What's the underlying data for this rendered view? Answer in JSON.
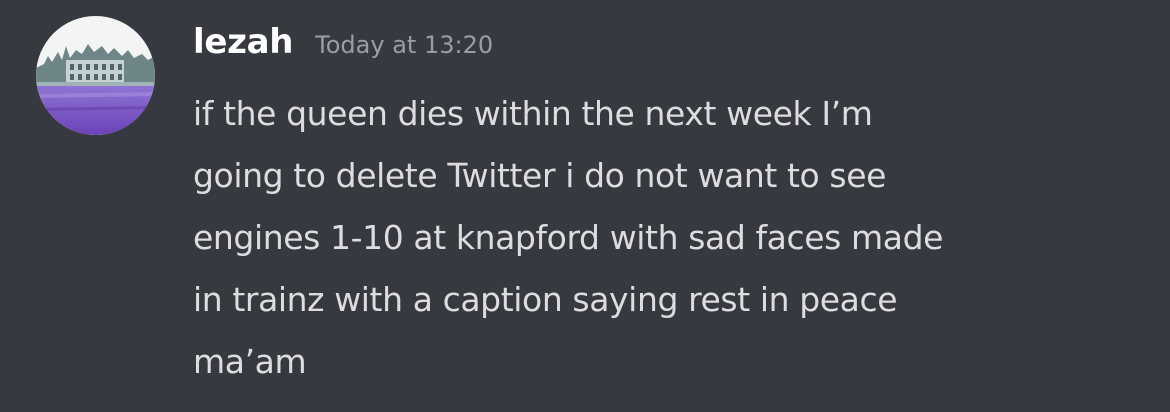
{
  "message": {
    "author": "lezah",
    "timestamp": "Today at 13:20",
    "avatar_icon": "avatar-image-building-purple",
    "text": "if the queen dies within the next week I’m\ngoing to delete Twitter i do not want to see\nengines 1-10 at knapford with sad faces made\nin trainz with a caption saying rest in peace\nma’am"
  },
  "colors": {
    "background": "#36393f",
    "username": "#ffffff",
    "timestamp": "#9a9da2",
    "text": "#dcddde",
    "avatar_sky": "#f4f6f6",
    "avatar_water": "#7d5bc7"
  }
}
